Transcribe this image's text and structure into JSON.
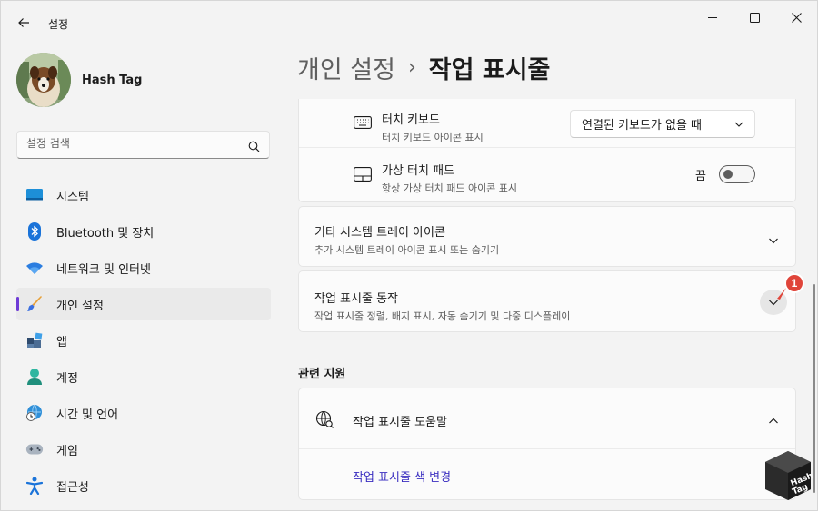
{
  "window": {
    "title": "설정"
  },
  "user": {
    "name": "Hash Tag"
  },
  "search": {
    "placeholder": "설정 검색"
  },
  "sidebar": {
    "items": [
      {
        "label": "시스템",
        "icon": "system-icon",
        "active": false
      },
      {
        "label": "Bluetooth 및 장치",
        "icon": "bluetooth-icon",
        "active": false
      },
      {
        "label": "네트워크 및 인터넷",
        "icon": "wifi-icon",
        "active": false
      },
      {
        "label": "개인 설정",
        "icon": "brush-icon",
        "active": true
      },
      {
        "label": "앱",
        "icon": "apps-icon",
        "active": false
      },
      {
        "label": "계정",
        "icon": "account-icon",
        "active": false
      },
      {
        "label": "시간 및 언어",
        "icon": "globe-clock-icon",
        "active": false
      },
      {
        "label": "게임",
        "icon": "gamepad-icon",
        "active": false
      },
      {
        "label": "접근성",
        "icon": "accessibility-icon",
        "active": false
      }
    ]
  },
  "breadcrumb": {
    "parent": "개인 설정",
    "separator": "›",
    "current": "작업 표시줄"
  },
  "settings": {
    "touch_keyboard": {
      "title": "터치 키보드",
      "subtitle": "터치 키보드 아이콘 표시",
      "value": "연결된 키보드가 없을 때"
    },
    "virtual_touchpad": {
      "title": "가상 터치 패드",
      "subtitle": "항상 가상 터치 패드 아이콘 표시",
      "state_label": "끔",
      "on": false
    },
    "other_tray": {
      "title": "기타 시스템 트레이 아이콘",
      "subtitle": "추가 시스템 트레이 아이콘 표시 또는 숨기기"
    },
    "behaviors": {
      "title": "작업 표시줄 동작",
      "subtitle": "작업 표시줄 정렬, 배지 표시, 자동 숨기기 및 다중 디스플레이",
      "badge": "1"
    }
  },
  "related": {
    "heading": "관련 지원",
    "help_title": "작업 표시줄 도움말",
    "link": "작업 표시줄 색 변경"
  },
  "watermark": {
    "line1": "Hash",
    "line2": "Tag"
  },
  "colors": {
    "accent": "#6e3bd6",
    "link": "#3a2ec0",
    "badge": "#e0453a"
  }
}
